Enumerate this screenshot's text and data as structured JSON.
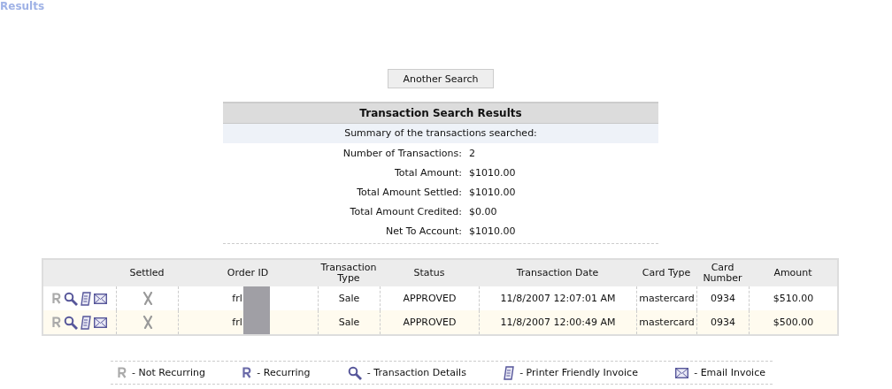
{
  "page_heading": "Results",
  "search_button": "Another Search",
  "summary": {
    "title": "Transaction Search Results",
    "subtitle": "Summary of the transactions searched:",
    "rows": [
      {
        "label": "Number of Transactions:",
        "value": "2"
      },
      {
        "label": "Total Amount:",
        "value": "$1010.00"
      },
      {
        "label": "Total Amount Settled:",
        "value": "$1010.00"
      },
      {
        "label": "Total Amount Credited:",
        "value": "$0.00"
      },
      {
        "label": "Net To Account:",
        "value": "$1010.00"
      }
    ]
  },
  "table": {
    "columns": [
      "Settled",
      "Order ID",
      "Transaction Type",
      "Status",
      "Transaction Date",
      "Card Type",
      "Card Number",
      "Amount"
    ],
    "rows": [
      {
        "recurring": false,
        "settled": false,
        "order_id": "frl",
        "redacted": true,
        "type": "Sale",
        "status": "APPROVED",
        "date": "11/8/2007 12:07:01 AM",
        "card_type": "mastercard",
        "card_number": "0934",
        "amount": "$510.00"
      },
      {
        "recurring": false,
        "settled": false,
        "order_id": "frl",
        "redacted": true,
        "type": "Sale",
        "status": "APPROVED",
        "date": "11/8/2007 12:00:49 AM",
        "card_type": "mastercard",
        "card_number": "0934",
        "amount": "$500.00"
      }
    ]
  },
  "legend": [
    {
      "kind": "not_recurring",
      "label": "- Not Recurring"
    },
    {
      "kind": "recurring",
      "label": "- Recurring"
    },
    {
      "kind": "details",
      "label": "- Transaction Details"
    },
    {
      "kind": "invoice",
      "label": "- Printer Friendly Invoice"
    },
    {
      "kind": "email",
      "label": "- Email Invoice"
    }
  ]
}
